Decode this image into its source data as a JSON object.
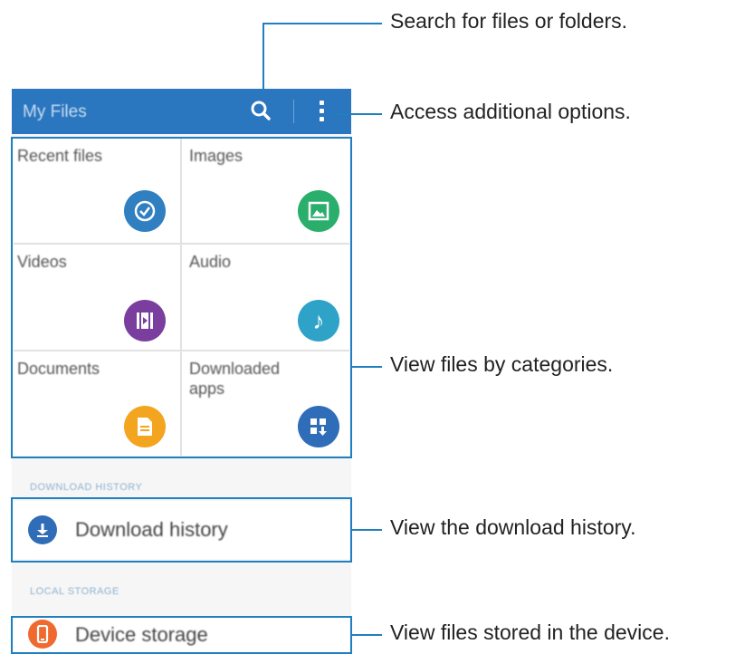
{
  "app": {
    "title": "My Files"
  },
  "categories": [
    {
      "label": "Recent files",
      "icon": "clock-icon",
      "color": "#2f7fc1"
    },
    {
      "label": "Images",
      "icon": "image-icon",
      "color": "#2aae6b"
    },
    {
      "label": "Videos",
      "icon": "film-icon",
      "color": "#7a3f9e"
    },
    {
      "label": "Audio",
      "icon": "music-note-icon",
      "color": "#2ea3c7"
    },
    {
      "label": "Documents",
      "icon": "document-icon",
      "color": "#f3a51f"
    },
    {
      "label": "Downloaded\napps",
      "icon": "apps-download-icon",
      "color": "#2f6db8"
    }
  ],
  "download_section": {
    "header": "DOWNLOAD HISTORY",
    "item": "Download history",
    "icon": "download-icon",
    "color": "#2f6db8"
  },
  "storage_section": {
    "header": "LOCAL STORAGE",
    "item": "Device storage",
    "icon": "phone-icon",
    "color": "#f06a2f"
  },
  "callouts": {
    "search": "Search for files or folders.",
    "options": "Access additional options.",
    "categories": "View files by categories.",
    "download": "View the download history.",
    "storage": "View files stored in the device."
  },
  "colors": {
    "appbar": "#2a76bf",
    "highlight": "#1f7fbf"
  }
}
